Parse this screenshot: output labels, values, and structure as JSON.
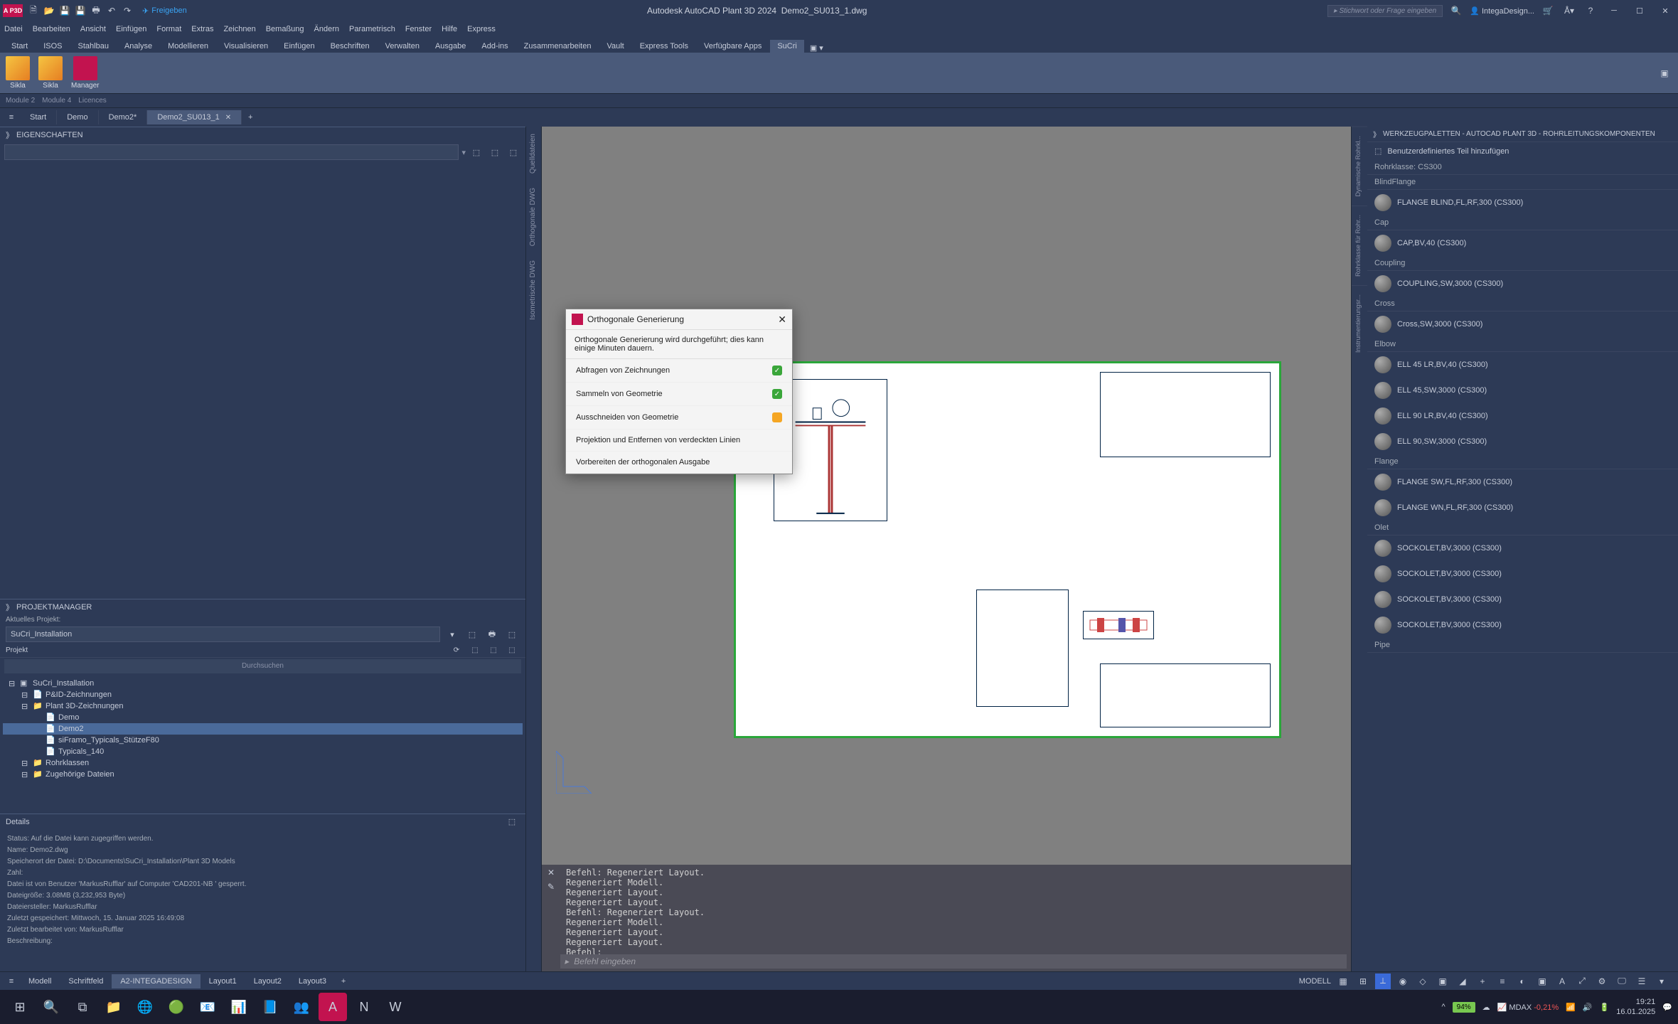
{
  "title": {
    "app": "Autodesk AutoCAD Plant 3D 2024",
    "doc": "Demo2_SU013_1.dwg",
    "logo": "A P3D"
  },
  "qat_share": "Freigeben",
  "search_hint": "Stichwort oder Frage eingeben",
  "user": "IntegaDesign...",
  "menu": [
    "Datei",
    "Bearbeiten",
    "Ansicht",
    "Einfügen",
    "Format",
    "Extras",
    "Zeichnen",
    "Bemaßung",
    "Ändern",
    "Parametrisch",
    "Fenster",
    "Hilfe",
    "Express"
  ],
  "ribbon_tabs": [
    "Start",
    "ISOS",
    "Stahlbau",
    "Analyse",
    "Modellieren",
    "Visualisieren",
    "Einfügen",
    "Beschriften",
    "Verwalten",
    "Ausgabe",
    "Add-ins",
    "Zusammenarbeiten",
    "Vault",
    "Express Tools",
    "Verfügbare Apps",
    "SuCri"
  ],
  "ribbon_active": 15,
  "ribbon_buttons": [
    {
      "label": "Sikla"
    },
    {
      "label": "Sikla"
    },
    {
      "label": "Manager",
      "styleClass": "mgr"
    }
  ],
  "modules": [
    "Module 2",
    "Module 4",
    "Licences"
  ],
  "file_tabs": [
    {
      "label": "Start"
    },
    {
      "label": "Demo"
    },
    {
      "label": "Demo2*"
    },
    {
      "label": "Demo2_SU013_1",
      "active": true,
      "closable": true
    }
  ],
  "properties_panel": "EIGENSCHAFTEN",
  "projmgr": {
    "title": "PROJEKTMANAGER",
    "current_label": "Aktuelles Projekt:",
    "current_value": "SuCri_Installation",
    "section": "Projekt",
    "search": "Durchsuchen",
    "tree": [
      {
        "indent": 0,
        "icon": "▣",
        "label": "SuCri_Installation"
      },
      {
        "indent": 1,
        "icon": "📄",
        "label": "P&ID-Zeichnungen"
      },
      {
        "indent": 1,
        "icon": "📁",
        "label": "Plant 3D-Zeichnungen"
      },
      {
        "indent": 2,
        "icon": "📄",
        "label": "Demo"
      },
      {
        "indent": 2,
        "icon": "📄",
        "label": "Demo2",
        "selected": true
      },
      {
        "indent": 2,
        "icon": "📄",
        "label": "siFramo_Typicals_StützeF80"
      },
      {
        "indent": 2,
        "icon": "📄",
        "label": "Typicals_140"
      },
      {
        "indent": 1,
        "icon": "📁",
        "label": "Rohrklassen"
      },
      {
        "indent": 1,
        "icon": "📁",
        "label": "Zugehörige Dateien"
      }
    ]
  },
  "details": {
    "title": "Details",
    "lines": [
      "Status: Auf die Datei kann zugegriffen werden.",
      "Name: Demo2.dwg",
      "Speicherort der Datei: D:\\Documents\\SuCri_Installation\\Plant 3D Models",
      "Zahl:",
      "Datei ist von Benutzer 'MarkusRufflar' auf Computer 'CAD201-NB ' gesperrt.",
      "Dateigröße: 3.08MB (3,232,953 Byte)",
      "Dateiersteller: MarkusRufflar",
      "Zuletzt gespeichert: Mittwoch, 15. Januar 2025 16:49:08",
      "Zuletzt bearbeitet von: MarkusRufflar",
      "Beschreibung:"
    ]
  },
  "vert_tabs": [
    "Quelldateien",
    "Orthogonale DWG",
    "Isometrische DWG"
  ],
  "cmd": {
    "history": "Befehl: Regeneriert Layout.\nRegeneriert Modell.\nRegeneriert Layout.\nRegeneriert Layout.\nBefehl: Regeneriert Layout.\nRegeneriert Modell.\nRegeneriert Layout.\nRegeneriert Layout.\nBefehl:",
    "prompt_icon": "▸",
    "placeholder": "Befehl eingeben"
  },
  "right": {
    "header": "WERKZEUGPALETTEN - AUTOCAD PLANT 3D - ROHRLEITUNGSKOMPONENTEN",
    "vtabs": [
      "Dynamische Rohrkl...",
      "Rohrklasse für Rohr...",
      "Instrumentierungsr..."
    ],
    "add_custom": "Benutzerdefiniertes Teil hinzufügen",
    "class": "Rohrklasse: CS300",
    "sections": [
      {
        "name": "BlindFlange",
        "items": [
          "FLANGE BLIND,FL,RF,300 (CS300)"
        ]
      },
      {
        "name": "Cap",
        "items": [
          "CAP,BV,40 (CS300)"
        ]
      },
      {
        "name": "Coupling",
        "items": [
          "COUPLING,SW,3000 (CS300)"
        ]
      },
      {
        "name": "Cross",
        "items": [
          "Cross,SW,3000 (CS300)"
        ]
      },
      {
        "name": "Elbow",
        "items": [
          "ELL 45 LR,BV,40 (CS300)",
          "ELL 45,SW,3000 (CS300)",
          "ELL 90 LR,BV,40 (CS300)",
          "ELL 90,SW,3000 (CS300)"
        ]
      },
      {
        "name": "Flange",
        "items": [
          "FLANGE SW,FL,RF,300 (CS300)",
          "FLANGE WN,FL,RF,300 (CS300)"
        ]
      },
      {
        "name": "Olet",
        "items": [
          "SOCKOLET,BV,3000 (CS300)",
          "SOCKOLET,BV,3000 (CS300)",
          "SOCKOLET,BV,3000 (CS300)",
          "SOCKOLET,BV,3000 (CS300)"
        ]
      },
      {
        "name": "Pipe",
        "items": []
      }
    ]
  },
  "layout_tabs": [
    "Modell",
    "Schriftfeld",
    "A2-INTEGADESIGN",
    "Layout1",
    "Layout2",
    "Layout3"
  ],
  "layout_active": 2,
  "status_model": "MODELL",
  "dialog": {
    "title": "Orthogonale Generierung",
    "msg": "Orthogonale Generierung wird durchgeführt; dies kann einige Minuten dauern.",
    "steps": [
      {
        "label": "Abfragen von Zeichnungen",
        "status": "ok"
      },
      {
        "label": "Sammeln von Geometrie",
        "status": "ok"
      },
      {
        "label": "Ausschneiden von Geometrie",
        "status": "prog"
      },
      {
        "label": "Projektion und Entfernen von verdeckten Linien",
        "status": ""
      },
      {
        "label": "Vorbereiten der orthogonalen Ausgabe",
        "status": ""
      }
    ]
  },
  "taskbar": {
    "battery": "94%",
    "stock_name": "MDAX",
    "stock_val": "-0,21%",
    "time": "19:21",
    "date": "16.01.2025"
  }
}
